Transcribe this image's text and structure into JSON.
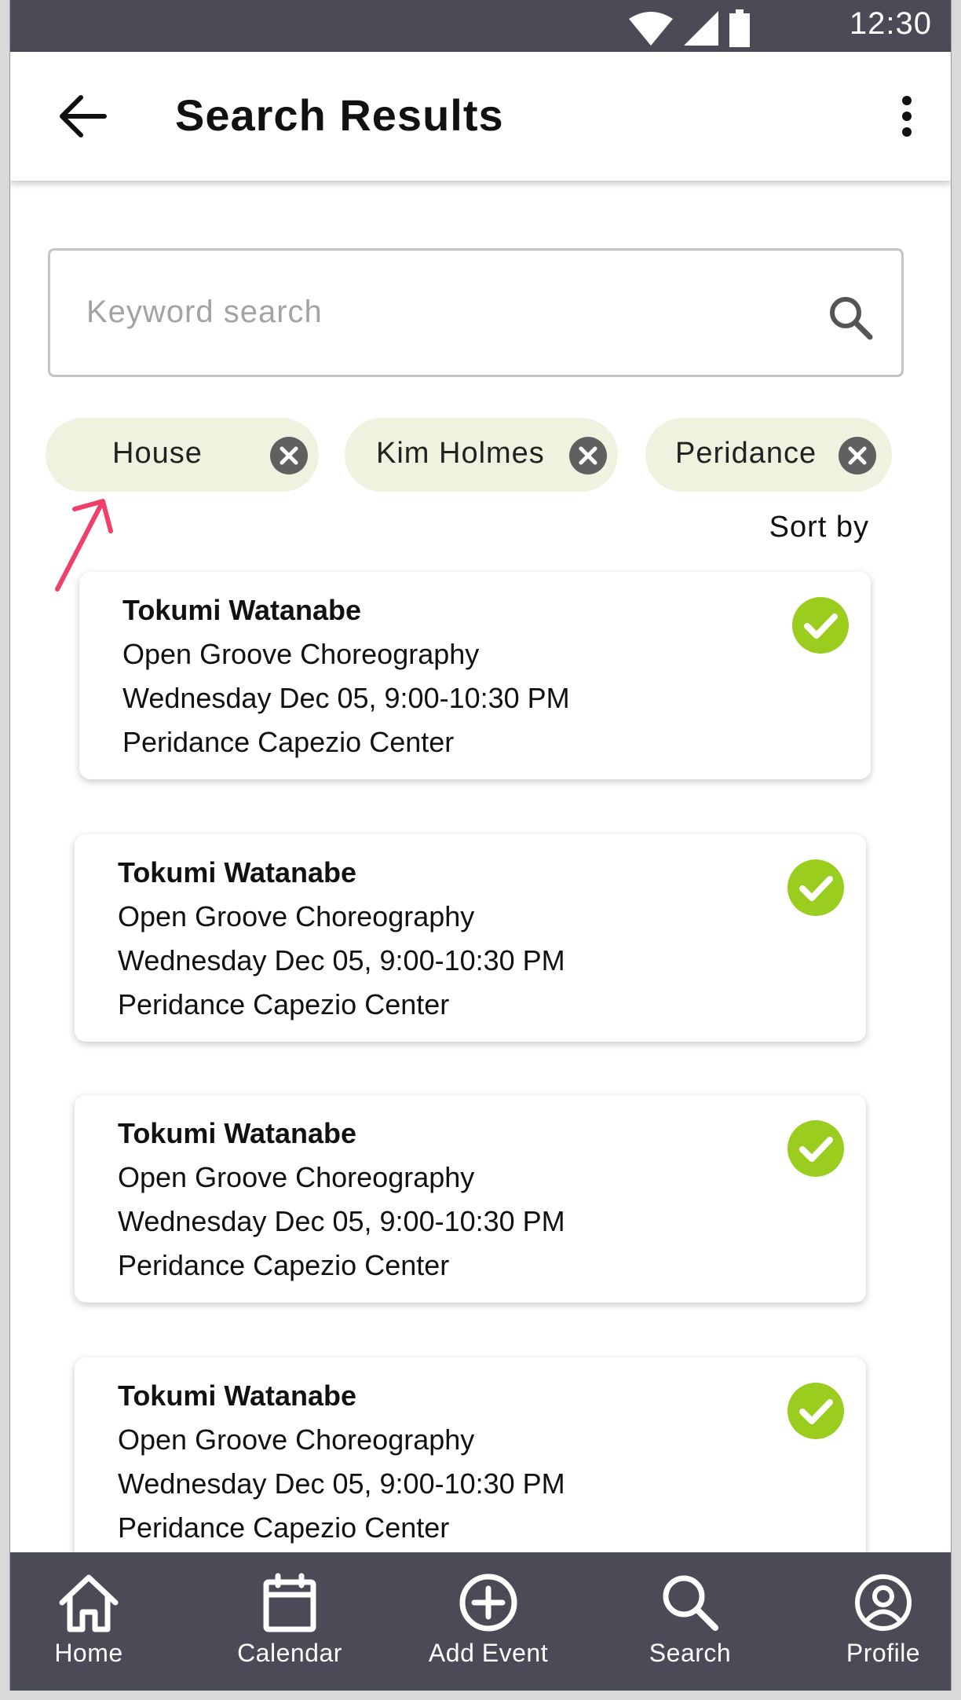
{
  "status_bar": {
    "time": "12:30"
  },
  "app_bar": {
    "title": "Search Results"
  },
  "search": {
    "placeholder": "Keyword search"
  },
  "filters": [
    {
      "label": "House"
    },
    {
      "label": "Kim Holmes"
    },
    {
      "label": "Peridance"
    }
  ],
  "sort_label": "Sort by",
  "results": [
    {
      "name": "Tokumi Watanabe",
      "class": "Open Groove Choreography",
      "time": "Wednesday Dec 05, 9:00-10:30 PM",
      "location": "Peridance Capezio Center"
    },
    {
      "name": "Tokumi Watanabe",
      "class": "Open Groove Choreography",
      "time": "Wednesday Dec 05, 9:00-10:30 PM",
      "location": "Peridance Capezio Center"
    },
    {
      "name": "Tokumi Watanabe",
      "class": "Open Groove Choreography",
      "time": "Wednesday Dec 05, 9:00-10:30 PM",
      "location": "Peridance Capezio Center"
    },
    {
      "name": "Tokumi Watanabe",
      "class": "Open Groove Choreography",
      "time": "Wednesday Dec 05, 9:00-10:30 PM",
      "location": "Peridance Capezio Center"
    }
  ],
  "nav": [
    {
      "label": "Home",
      "icon": "home-icon"
    },
    {
      "label": "Calendar",
      "icon": "calendar-icon"
    },
    {
      "label": "Add Event",
      "icon": "add-circle-icon"
    },
    {
      "label": "Search",
      "icon": "search-icon"
    },
    {
      "label": "Profile",
      "icon": "profile-icon"
    }
  ],
  "colors": {
    "bar": "#4a4b56",
    "chip": "#eef2de",
    "check": "#9acd1e",
    "annotation_arrow": "#f0406a"
  }
}
